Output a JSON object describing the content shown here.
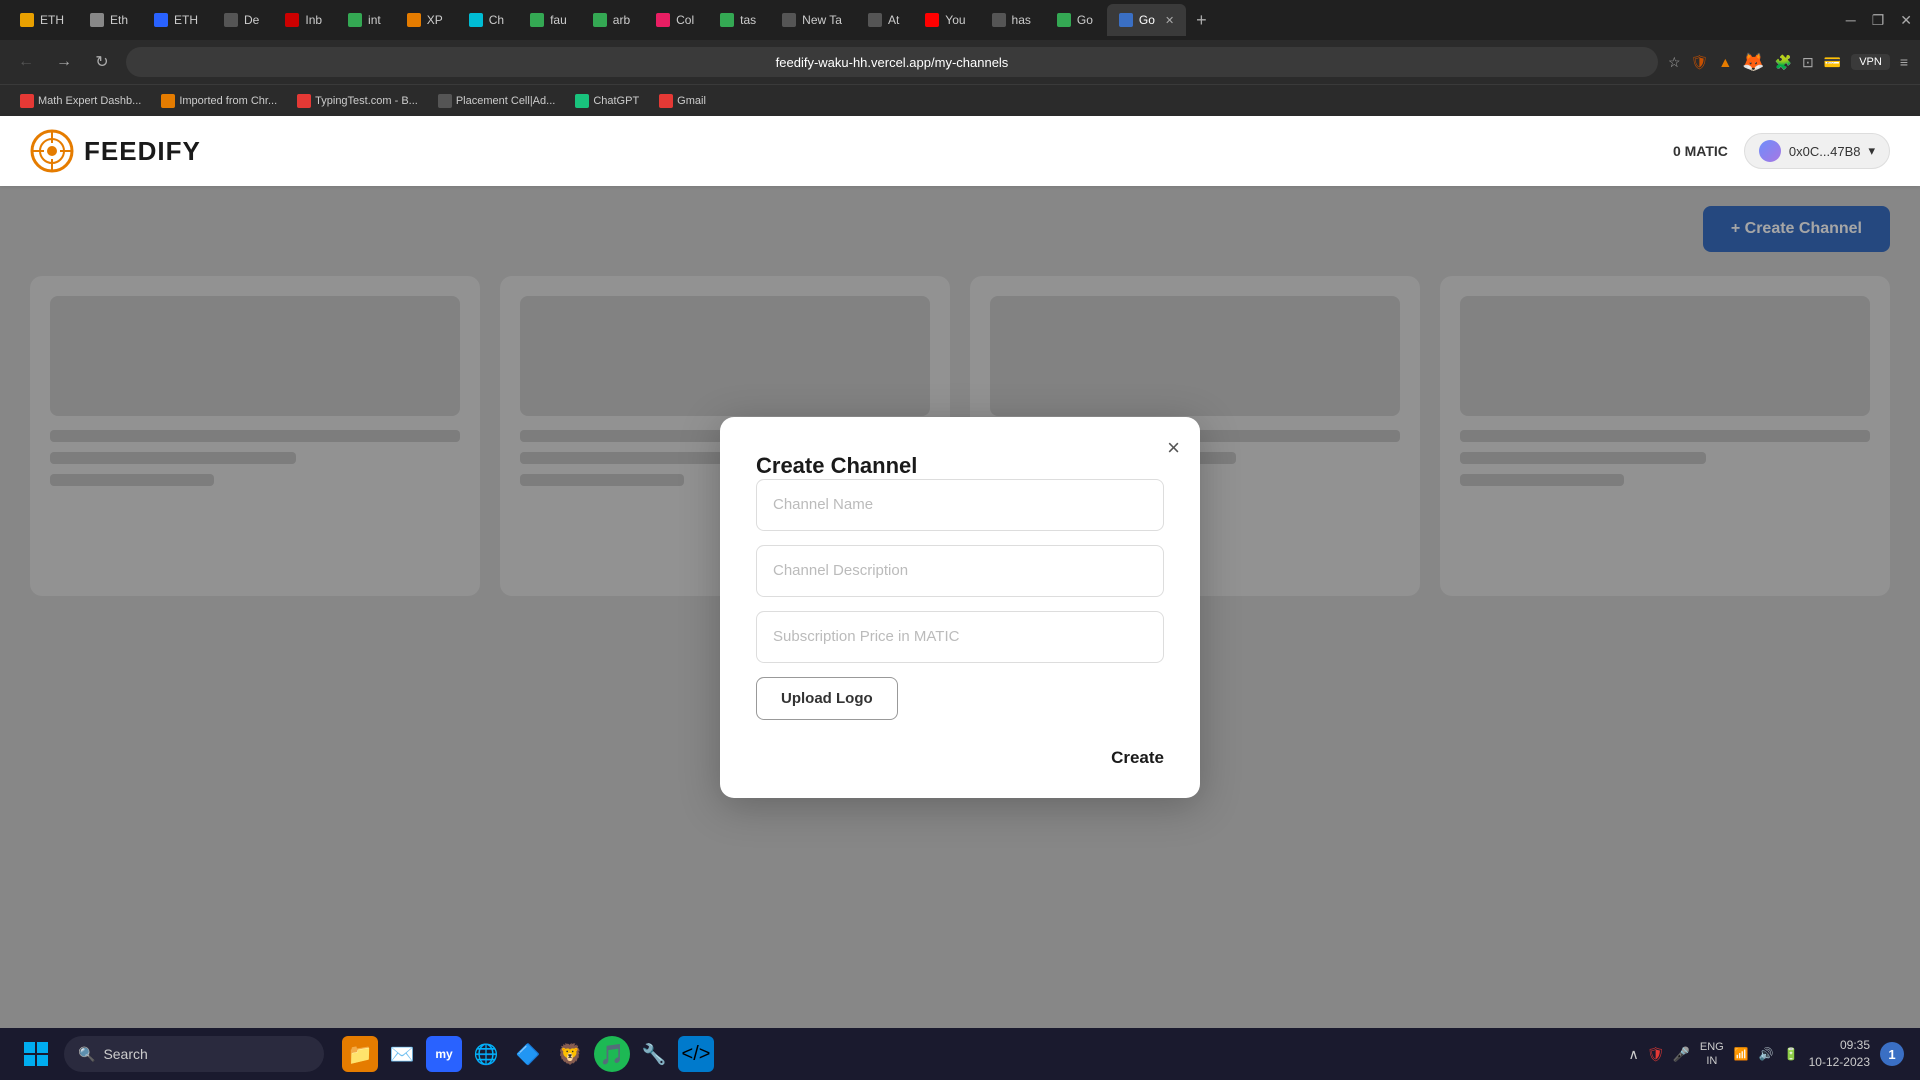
{
  "browser": {
    "tabs": [
      {
        "id": "t1",
        "favicon_color": "#e8a000",
        "label": "ETH",
        "active": false
      },
      {
        "id": "t2",
        "favicon_color": "#444",
        "label": "Eth",
        "active": false
      },
      {
        "id": "t3",
        "favicon_color": "#2962ff",
        "label": "ETH",
        "active": false
      },
      {
        "id": "t4",
        "favicon_color": "#555",
        "label": "De",
        "active": false
      },
      {
        "id": "t5",
        "favicon_color": "#c00",
        "label": "Inb",
        "active": false
      },
      {
        "id": "t6",
        "favicon_color": "#34a853",
        "label": "int",
        "active": false
      },
      {
        "id": "t7",
        "favicon_color": "#e57c00",
        "label": "XP",
        "active": false
      },
      {
        "id": "t8",
        "favicon_color": "#00bcd4",
        "label": "Ch",
        "active": false
      },
      {
        "id": "t9",
        "favicon_color": "#34a853",
        "label": "fau",
        "active": false
      },
      {
        "id": "t10",
        "favicon_color": "#34a853",
        "label": "arb",
        "active": false
      },
      {
        "id": "t11",
        "favicon_color": "#e91e63",
        "label": "Col",
        "active": false
      },
      {
        "id": "t12",
        "favicon_color": "#34a853",
        "label": "tas",
        "active": false
      },
      {
        "id": "t13",
        "favicon_color": "#444",
        "label": "New Ta",
        "active": false
      },
      {
        "id": "t14",
        "favicon_color": "#444",
        "label": "At",
        "active": false
      },
      {
        "id": "t15",
        "favicon_color": "#f00",
        "label": "You",
        "active": false
      },
      {
        "id": "t16",
        "favicon_color": "#444",
        "label": "has",
        "active": false
      },
      {
        "id": "t17",
        "favicon_color": "#34a853",
        "label": "Go",
        "active": false
      },
      {
        "id": "t18",
        "favicon_color": "#34a853",
        "label": "Go",
        "active": true
      }
    ],
    "address": "feedify-waku-hh.vercel.app/my-channels",
    "bookmarks": [
      {
        "label": "Math Expert Dashb...",
        "icon_color": "#e53935"
      },
      {
        "label": "Imported from Chr...",
        "icon_color": "#e57c00"
      },
      {
        "label": "TypingTest.com - B...",
        "icon_color": "#e53935"
      },
      {
        "label": "Placement Cell|Ad...",
        "icon_color": "#555"
      },
      {
        "label": "ChatGPT",
        "icon_color": "#444"
      },
      {
        "label": "Gmail",
        "icon_color": "#e53935"
      }
    ]
  },
  "app": {
    "logo_text": "FEEDIFY",
    "balance": "0 MATIC",
    "wallet_address": "0x0C...47B8",
    "create_channel_btn": "+ Create Channel",
    "cards": [
      {
        "id": "c1"
      },
      {
        "id": "c2"
      },
      {
        "id": "c3"
      },
      {
        "id": "c4"
      }
    ]
  },
  "modal": {
    "title": "Create Channel",
    "channel_name_placeholder": "Channel Name",
    "channel_desc_placeholder": "Channel Description",
    "subscription_price_placeholder": "Subscription Price in MATIC",
    "upload_logo_label": "Upload Logo",
    "create_label": "Create",
    "close_label": "×"
  },
  "taskbar": {
    "search_placeholder": "Search",
    "time": "09:35",
    "date": "10-12-2023",
    "lang": "ENG\nIN",
    "notification_count": "1"
  }
}
